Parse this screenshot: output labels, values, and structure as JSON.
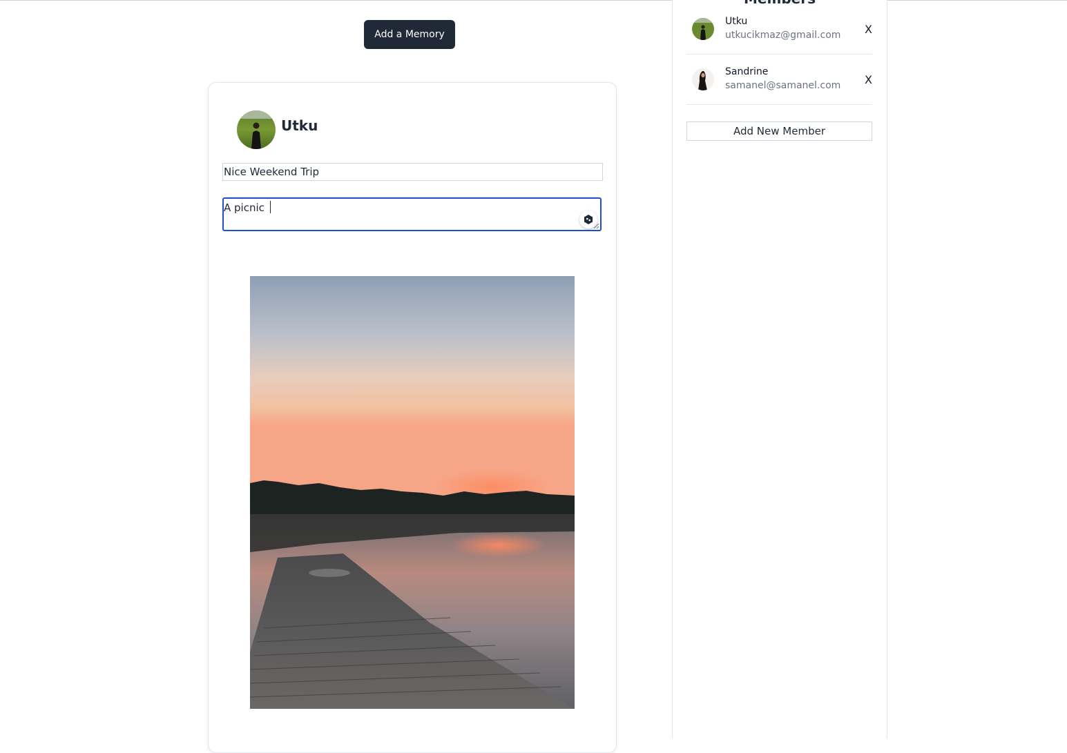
{
  "main": {
    "add_memory_label": "Add a Memory",
    "memory": {
      "author_name": "Utku",
      "title_value": "Nice Weekend Trip",
      "description_value": "A picnic "
    }
  },
  "members_panel": {
    "heading": "Members",
    "remove_label": "X",
    "members": [
      {
        "name": "Utku",
        "email": "utkucikmaz@gmail.com"
      },
      {
        "name": "Sandrine",
        "email": "samanel@samanel.com"
      }
    ],
    "add_member_label": "Add New Member"
  },
  "colors": {
    "primary_button": "#1f2937",
    "focus_border": "#1d4ed8",
    "muted_text": "#6b7280",
    "divider": "#e5e7eb"
  },
  "icons": {
    "grammar_assistant": "grammar-assistant-icon",
    "resize": "resize-handle-icon"
  }
}
